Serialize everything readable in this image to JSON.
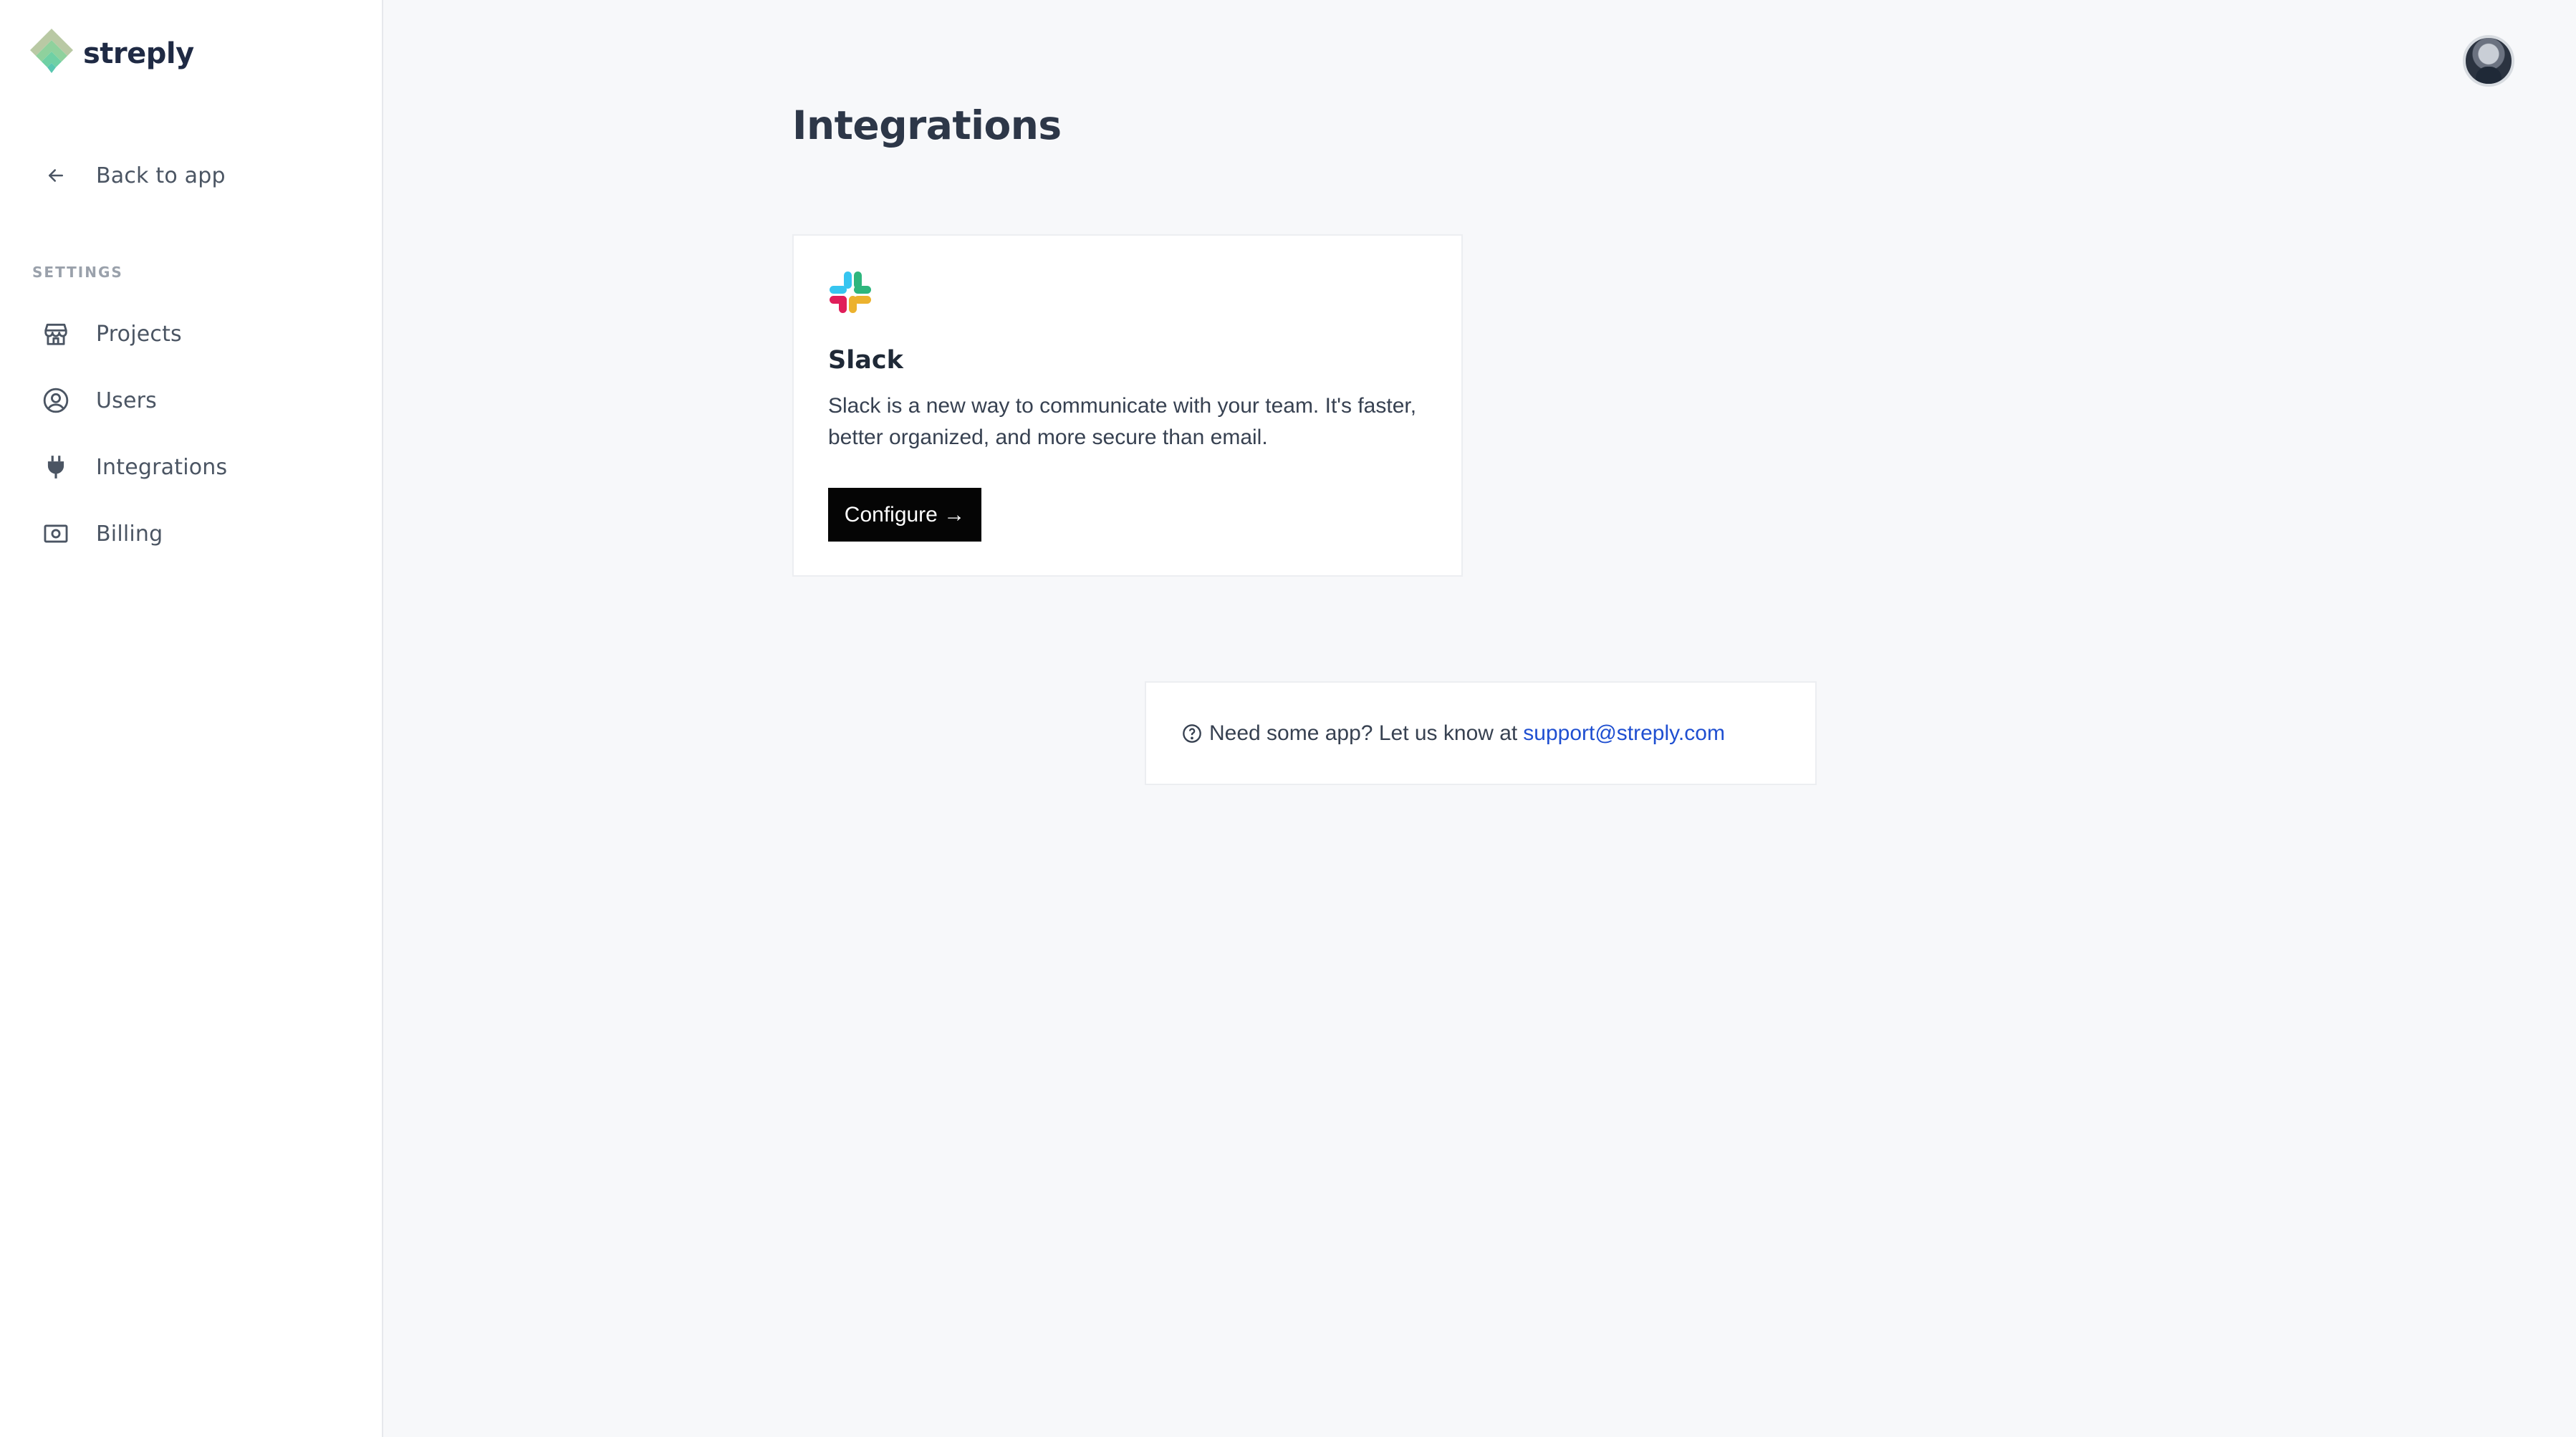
{
  "app": {
    "name": "streply"
  },
  "sidebar": {
    "back_label": "Back to app",
    "section_title": "SETTINGS",
    "items": [
      {
        "label": "Projects",
        "icon": "store-icon"
      },
      {
        "label": "Users",
        "icon": "user-circle-icon"
      },
      {
        "label": "Integrations",
        "icon": "plug-icon"
      },
      {
        "label": "Billing",
        "icon": "banknote-icon"
      }
    ]
  },
  "header": {
    "avatar": "user-avatar"
  },
  "main": {
    "title": "Integrations",
    "integration": {
      "name": "Slack",
      "description": "Slack is a new way to communicate with your team. It's faster, better organized, and more secure than email.",
      "button_label": "Configure →",
      "icon": "slack-icon"
    },
    "help": {
      "text": "Need some app? Let us know at",
      "email": "support@streply.com",
      "icon": "question-circle-icon"
    }
  },
  "colors": {
    "brand_green": "#7fd08f",
    "button": "#050505",
    "link": "#1f4fd1"
  }
}
